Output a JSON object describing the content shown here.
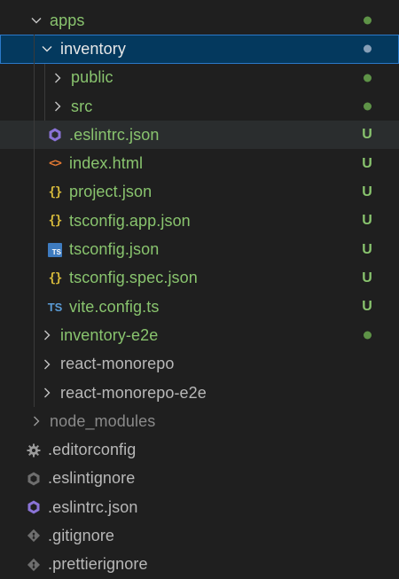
{
  "explorer": {
    "items": [
      {
        "label": "apps",
        "status": "dot"
      },
      {
        "label": "inventory",
        "status": "dot"
      },
      {
        "label": "public",
        "status": "dot"
      },
      {
        "label": "src",
        "status": "dot"
      },
      {
        "label": ".eslintrc.json",
        "status": "U"
      },
      {
        "label": "index.html",
        "status": "U"
      },
      {
        "label": "project.json",
        "status": "U"
      },
      {
        "label": "tsconfig.app.json",
        "status": "U"
      },
      {
        "label": "tsconfig.json",
        "status": "U"
      },
      {
        "label": "tsconfig.spec.json",
        "status": "U"
      },
      {
        "label": "vite.config.ts",
        "status": "U"
      },
      {
        "label": "inventory-e2e",
        "status": "dot"
      },
      {
        "label": "react-monorepo",
        "status": ""
      },
      {
        "label": "react-monorepo-e2e",
        "status": ""
      },
      {
        "label": "node_modules",
        "status": ""
      },
      {
        "label": ".editorconfig",
        "status": ""
      },
      {
        "label": ".eslintignore",
        "status": ""
      },
      {
        "label": ".eslintrc.json",
        "status": ""
      },
      {
        "label": ".gitignore",
        "status": ""
      },
      {
        "label": ".prettierignore",
        "status": ""
      }
    ]
  },
  "icons": {
    "eslint": "eslint-icon",
    "html": "html-icon",
    "json": "json-icon",
    "ts_config": "typescript-config-icon",
    "ts": "typescript-icon",
    "gear": "gear-icon",
    "git": "git-icon"
  },
  "colors": {
    "background": "#1f1f1f",
    "selected_background": "#04395e",
    "selected_border": "#2b79c9",
    "untracked_green": "#89c46e",
    "modified_dot": "#6aa84f"
  }
}
